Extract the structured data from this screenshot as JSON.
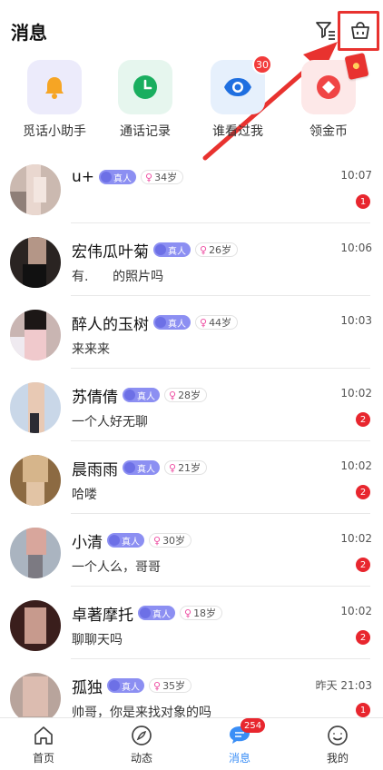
{
  "header": {
    "title": "消息"
  },
  "quick_actions": [
    {
      "label": "觅话小助手",
      "icon": "bell-icon",
      "bg": "#ecebfb",
      "color": "#f6a524"
    },
    {
      "label": "通话记录",
      "icon": "clock-icon",
      "bg": "#e6f6ee",
      "color": "#1aae5f"
    },
    {
      "label": "谁看过我",
      "icon": "eye-icon",
      "bg": "#e6f0fc",
      "color": "#1f6fe0",
      "badge": "30"
    },
    {
      "label": "领金币",
      "icon": "coin-icon",
      "bg": "#fde8e8",
      "color": "#f04545"
    }
  ],
  "conversations": [
    {
      "name": "u+",
      "real_tag": "真人",
      "age": "34岁",
      "preview": "",
      "time": "10:07",
      "unread": "1"
    },
    {
      "name": "宏伟瓜叶菊",
      "real_tag": "真人",
      "age": "26岁",
      "preview": "有.      的照片吗",
      "time": "10:06",
      "unread": ""
    },
    {
      "name": "醉人的玉树",
      "real_tag": "真人",
      "age": "44岁",
      "preview": "来来来",
      "time": "10:03",
      "unread": ""
    },
    {
      "name": "苏倩倩",
      "real_tag": "真人",
      "age": "28岁",
      "preview": "一个人好无聊",
      "time": "10:02",
      "unread": "2"
    },
    {
      "name": "晨雨雨",
      "real_tag": "真人",
      "age": "21岁",
      "preview": "哈喽",
      "time": "10:02",
      "unread": "2"
    },
    {
      "name": "小清",
      "real_tag": "真人",
      "age": "30岁",
      "preview": "一个人么，哥哥",
      "time": "10:02",
      "unread": "2"
    },
    {
      "name": "卓著摩托",
      "real_tag": "真人",
      "age": "18岁",
      "preview": "聊聊天吗",
      "time": "10:02",
      "unread": "2"
    },
    {
      "name": "孤独",
      "real_tag": "真人",
      "age": "35岁",
      "preview": "帅哥，你是来找对象的吗",
      "time": "昨天 21:03",
      "unread": "1"
    }
  ],
  "tabbar": {
    "tabs": [
      {
        "label": "首页",
        "icon": "home-icon"
      },
      {
        "label": "动态",
        "icon": "compass-icon"
      },
      {
        "label": "消息",
        "icon": "chat-icon",
        "badge": "254"
      },
      {
        "label": "我的",
        "icon": "profile-icon"
      }
    ]
  },
  "colors": {
    "accent": "#3a8ef6",
    "annotation": "#e8322f",
    "badge": "#e8262e"
  }
}
